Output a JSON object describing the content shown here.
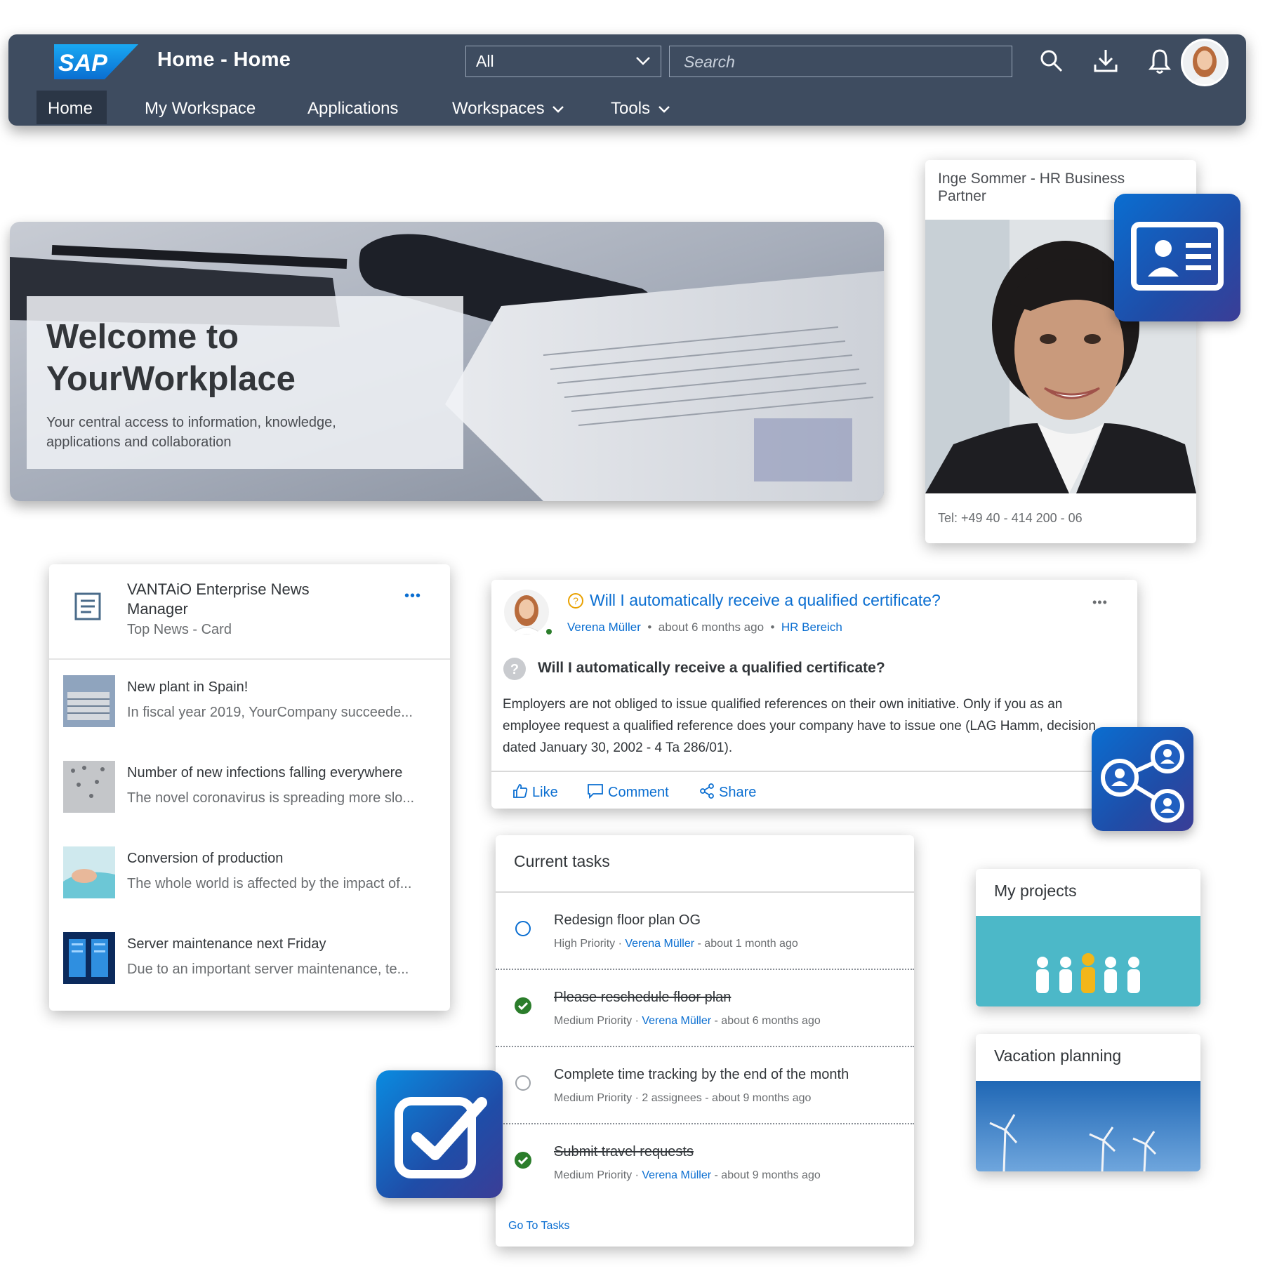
{
  "shell": {
    "logo_text": "SAP",
    "title": "Home - Home",
    "scope_value": "All",
    "search_placeholder": "Search",
    "nav": [
      "Home",
      "My Workspace",
      "Applications",
      "Workspaces",
      "Tools"
    ]
  },
  "hero": {
    "title": "Welcome to YourWorkplace",
    "subtitle": "Your central access to information, knowledge, applications and collaboration"
  },
  "contact": {
    "name": "Inge Sommer - HR Business Partner",
    "tel": "Tel: +49 40 - 414 200 - 06"
  },
  "news": {
    "title": "VANTAiO Enterprise News Manager",
    "subtitle": "Top News - Card",
    "more": "•••",
    "items": [
      {
        "headline": "New plant in Spain!",
        "teaser": "In fiscal year 2019, YourCompany succeede..."
      },
      {
        "headline": "Number of new infections falling everywhere",
        "teaser": "The novel coronavirus is spreading more slo..."
      },
      {
        "headline": "Conversion of production",
        "teaser": "The whole world is affected by the impact of..."
      },
      {
        "headline": "Server maintenance next Friday",
        "teaser": "Due to an important server maintenance, te..."
      }
    ]
  },
  "post": {
    "title": "Will I automatically receive a qualified certificate?",
    "author": "Verena Müller",
    "time": "about 6 months ago",
    "group": "HR Bereich",
    "heading": "Will I automatically receive a qualified certificate?",
    "body": "Employers are not obliged to issue qualified references on their own initiative. Only if you as an employee request a qualified reference does your company have to issue one (LAG Hamm, decision dated January 30, 2002 - 4 Ta 286/01).",
    "actions": {
      "like": "Like",
      "comment": "Comment",
      "share": "Share"
    },
    "more": "•••"
  },
  "tasks": {
    "title": "Current tasks",
    "items": [
      {
        "title": "Redesign floor plan OG",
        "priority": "High Priority",
        "who": "Verena Müller",
        "when": "about 1 month ago",
        "done": false
      },
      {
        "title": "Please reschedule floor plan",
        "priority": "Medium Priority",
        "who": "Verena Müller",
        "when": "about 6 months ago",
        "done": true
      },
      {
        "title": "Complete time tracking by the end of the month",
        "priority": "Medium Priority",
        "who": "2 assignees",
        "when": "about 9 months ago",
        "done": false
      },
      {
        "title": "Submit travel requests",
        "priority": "Medium Priority",
        "who": "Verena Müller",
        "when": "about 9 months ago",
        "done": true
      }
    ],
    "link": "Go To Tasks"
  },
  "tiles": {
    "projects": "My projects",
    "vacation": "Vacation planning"
  },
  "colors": {
    "shell": "#3e4c60",
    "link": "#0a6ed1",
    "done": "#2b7d2b"
  }
}
